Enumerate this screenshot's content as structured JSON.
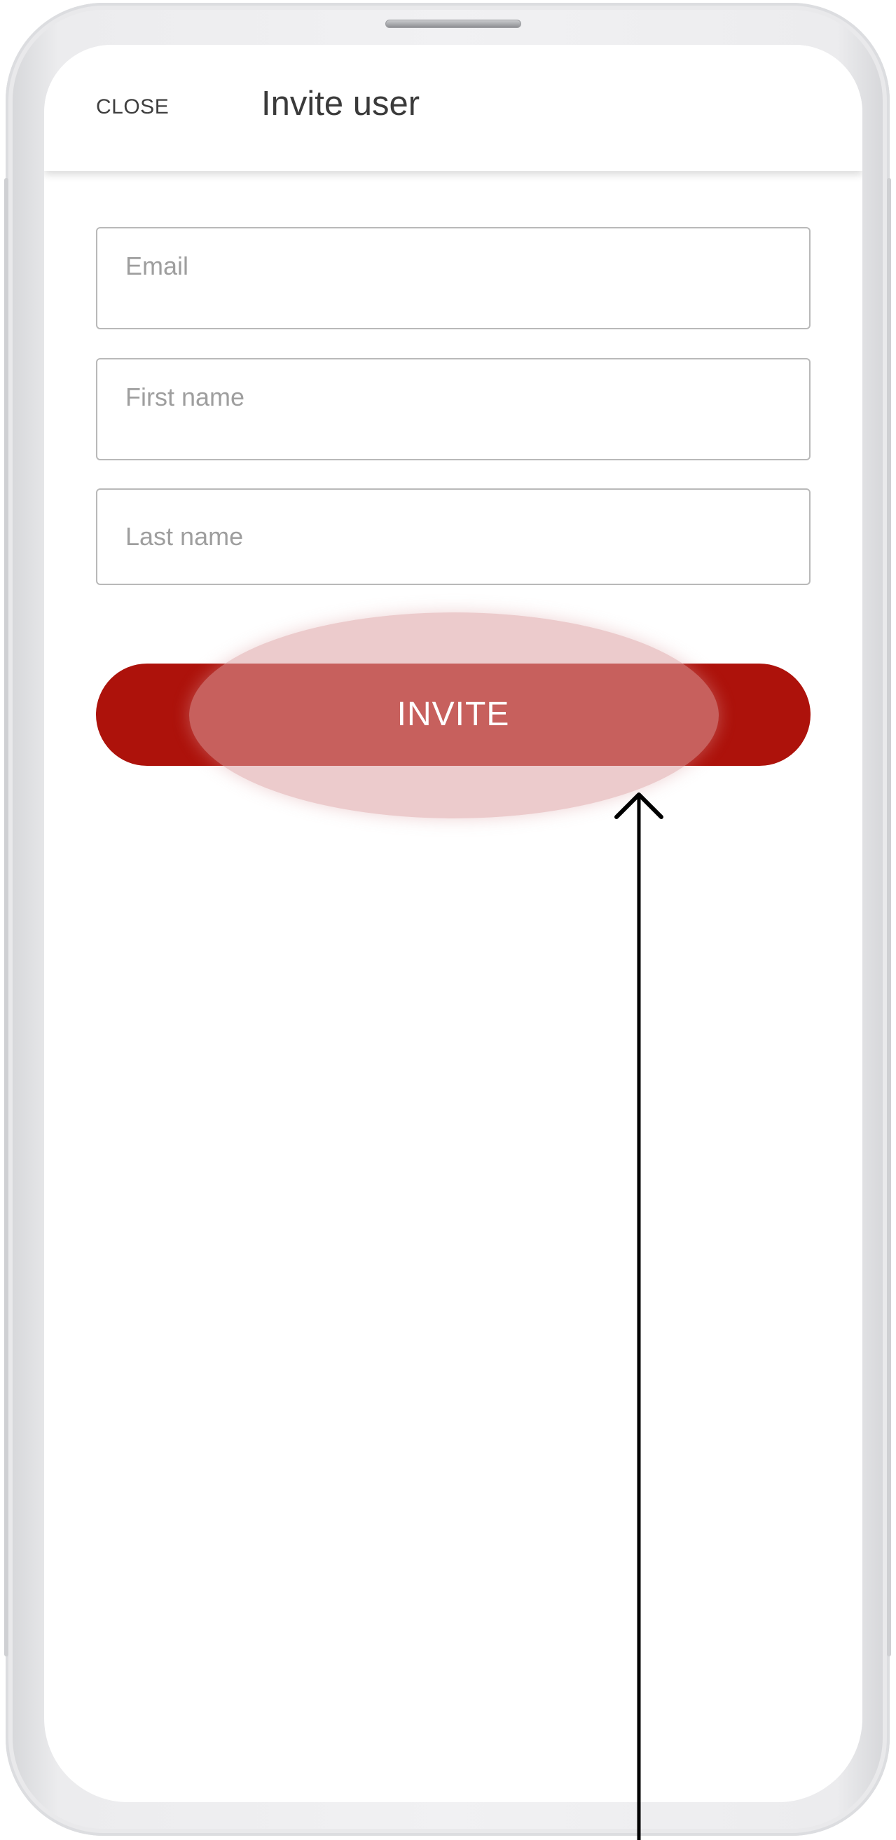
{
  "header": {
    "close_label": "CLOSE",
    "title": "Invite user"
  },
  "form": {
    "email_placeholder": "Email",
    "first_name_placeholder": "First name",
    "last_name_placeholder": "Last name",
    "invite_label": "INVITE"
  },
  "colors": {
    "accent": "#ad120b",
    "tap_highlight": "#e0a8aa",
    "annotation_arrow": "#000000"
  }
}
